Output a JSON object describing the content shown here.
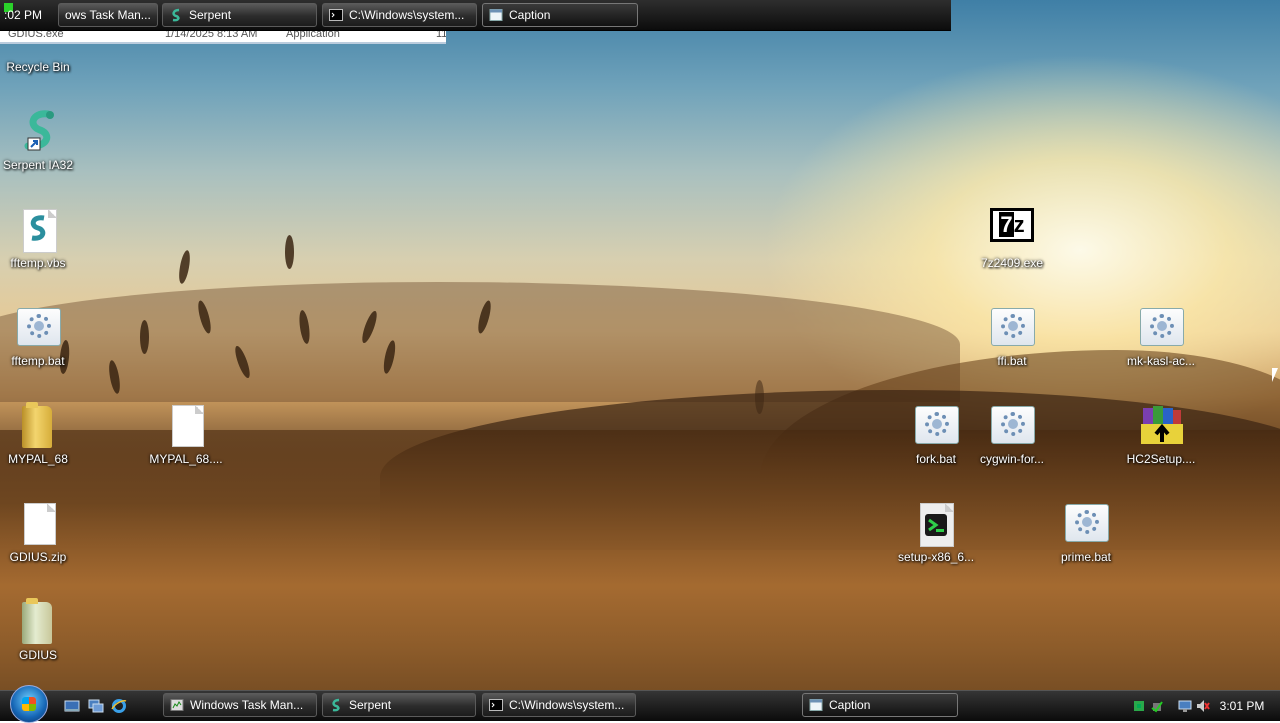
{
  "top_taskbar": {
    "clock_fragment": ":02 PM",
    "buttons": [
      {
        "label": "ows Task Man...",
        "icon": "task-manager-icon"
      },
      {
        "label": "Serpent",
        "icon": "serpent-icon"
      },
      {
        "label": "C:\\Windows\\system...",
        "icon": "cmd-icon"
      },
      {
        "label": "Caption",
        "icon": "window-icon"
      }
    ]
  },
  "explorer_row": {
    "name": "GDIUS.exe",
    "date": "1/14/2025 8:13 AM",
    "type": "Application",
    "size": "11"
  },
  "desktop_icons": [
    {
      "label": "Recycle Bin",
      "icon": "recycle-bin-icon"
    },
    {
      "label": "Serpent IA32",
      "icon": "serpent-shortcut-icon"
    },
    {
      "label": "fftemp.vbs",
      "icon": "vbs-script-icon"
    },
    {
      "label": "fftemp.bat",
      "icon": "batch-file-icon"
    },
    {
      "label": "MYPAL_68",
      "icon": "folder-icon"
    },
    {
      "label": "MYPAL_68....",
      "icon": "blank-file-icon"
    },
    {
      "label": "GDIUS.zip",
      "icon": "zip-file-icon"
    },
    {
      "label": "GDIUS",
      "icon": "folder-icon"
    },
    {
      "label": "7z2409.exe",
      "icon": "7zip-installer-icon"
    },
    {
      "label": "ffi.bat",
      "icon": "batch-file-icon"
    },
    {
      "label": "mk-kasl-ac...",
      "icon": "batch-file-icon"
    },
    {
      "label": "fork.bat",
      "icon": "batch-file-icon"
    },
    {
      "label": "cygwin-for...",
      "icon": "batch-file-icon"
    },
    {
      "label": "HC2Setup....",
      "icon": "winrar-archive-icon"
    },
    {
      "label": "setup-x86_6...",
      "icon": "cygwin-setup-icon"
    },
    {
      "label": "prime.bat",
      "icon": "batch-file-icon"
    }
  ],
  "taskbar": {
    "buttons": [
      {
        "label": "Windows Task Man...",
        "icon": "task-manager-icon"
      },
      {
        "label": "Serpent",
        "icon": "serpent-icon"
      },
      {
        "label": "C:\\Windows\\system...",
        "icon": "cmd-icon"
      },
      {
        "label": "Caption",
        "icon": "window-icon"
      }
    ],
    "quick_launch": [
      "show-desktop-icon",
      "switch-windows-icon",
      "internet-explorer-icon"
    ],
    "tray_icons": [
      "network-icon",
      "safely-remove-icon",
      "display-icon",
      "volume-muted-icon"
    ],
    "clock": "3:01 PM"
  },
  "colors": {
    "taskbar": "#111111",
    "sky_top": "#3f7fa6",
    "sun": "#fff6d8"
  }
}
